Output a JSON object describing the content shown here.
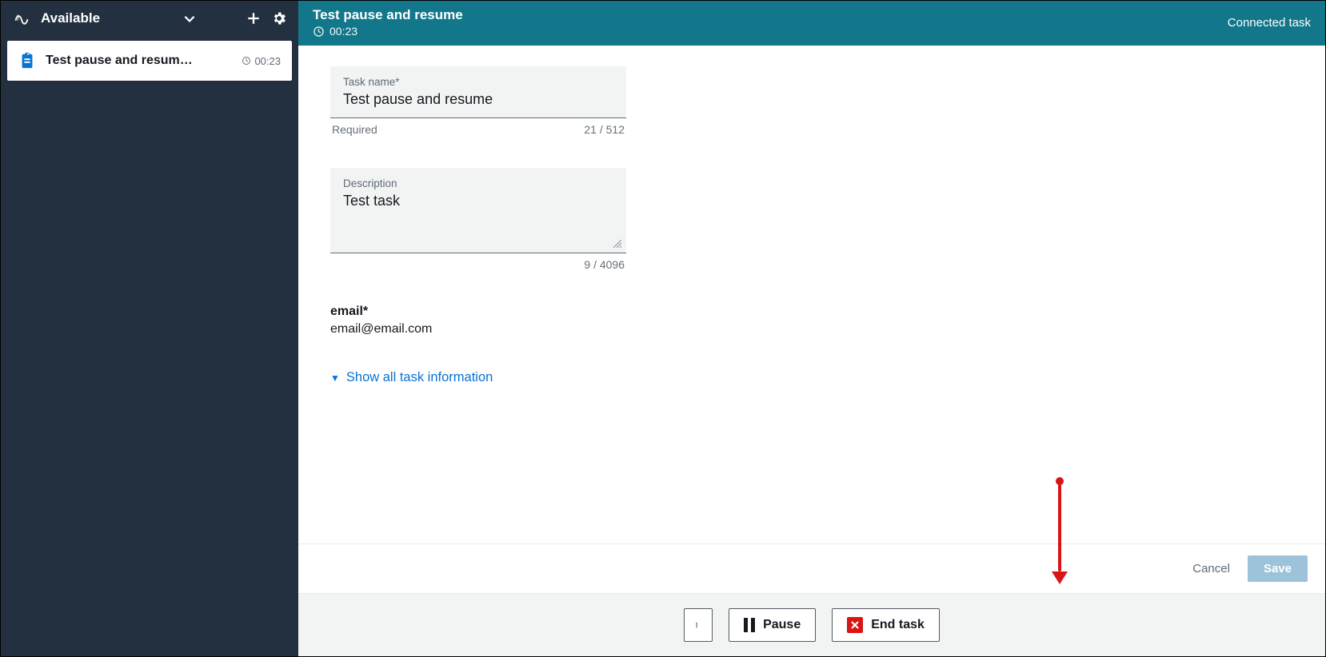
{
  "sidebar": {
    "status_label": "Available",
    "task": {
      "title": "Test pause and resum…",
      "elapsed": "00:23"
    }
  },
  "header": {
    "title": "Test pause and resume",
    "elapsed": "00:23",
    "right_label": "Connected task"
  },
  "form": {
    "name_label": "Task name*",
    "name_value": "Test pause and resume",
    "name_helper_left": "Required",
    "name_helper_right": "21 / 512",
    "desc_label": "Description",
    "desc_value": "Test task",
    "desc_helper_right": "9 / 4096",
    "email_label": "email*",
    "email_value": "email@email.com",
    "expand_label": "Show all task information"
  },
  "footer": {
    "cancel": "Cancel",
    "save": "Save",
    "pause": "Pause",
    "end": "End task"
  }
}
